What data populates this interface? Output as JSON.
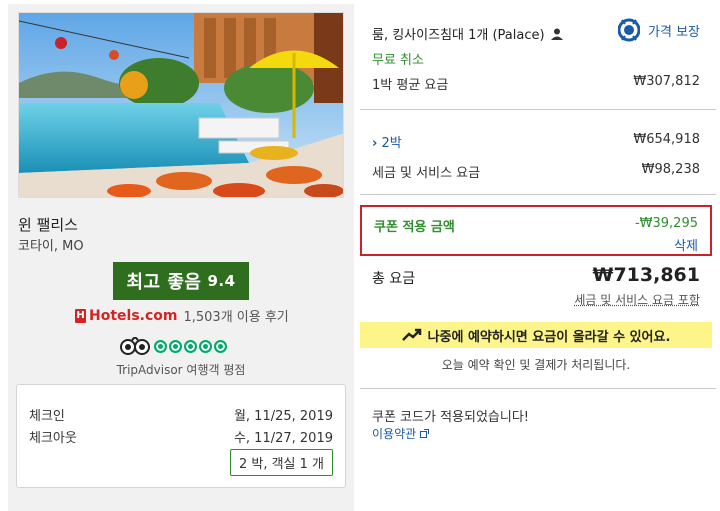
{
  "hotel": {
    "name": "윈 팰리스",
    "location": "코타이, MO",
    "rating_label": "최고 좋음",
    "rating_score": "9.4",
    "hotels_brand": "Hotels.com",
    "reviews_text": "1,503개 이용 후기",
    "tripadvisor_label": "TripAdvisor 여행객 평점",
    "tripadvisor_rating": 5
  },
  "dates": {
    "checkin_label": "체크인",
    "checkin_value": "월, 11/25, 2019",
    "checkout_label": "체크아웃",
    "checkout_value": "수, 11/27, 2019",
    "nights_rooms": "2 박, 객실 1 개"
  },
  "summary": {
    "room_desc": "룸, 킹사이즈침대 1개 (Palace)",
    "price_guarantee": "가격 보장",
    "free_cancel": "무료 취소",
    "avg_nightly_label": "1박 평균 요금",
    "avg_nightly_value": "₩307,812",
    "nights_label": "2박",
    "nights_value": "₩654,918",
    "tax_label": "세금 및 서비스 요금",
    "tax_value": "₩98,238",
    "coupon_label": "쿠폰 적용 금액",
    "coupon_value": "-₩39,295",
    "coupon_delete": "삭제",
    "total_label": "총 요금",
    "total_value": "₩713,861",
    "total_note": "세금 및 서비스 요금 포함",
    "banner_text": "나중에 예약하시면 요금이 올라갈 수 있어요.",
    "confirm_note": "오늘 예약 확인 및 결제가 처리됩니다.",
    "coupon_applied": "쿠폰 코드가 적용되었습니다!",
    "terms_link": "이용약관"
  },
  "colors": {
    "rating_green": "#2f6e1f",
    "link_blue": "#1a5aa8",
    "coupon_border": "#c8222a",
    "banner_yellow": "#fdf58a"
  }
}
